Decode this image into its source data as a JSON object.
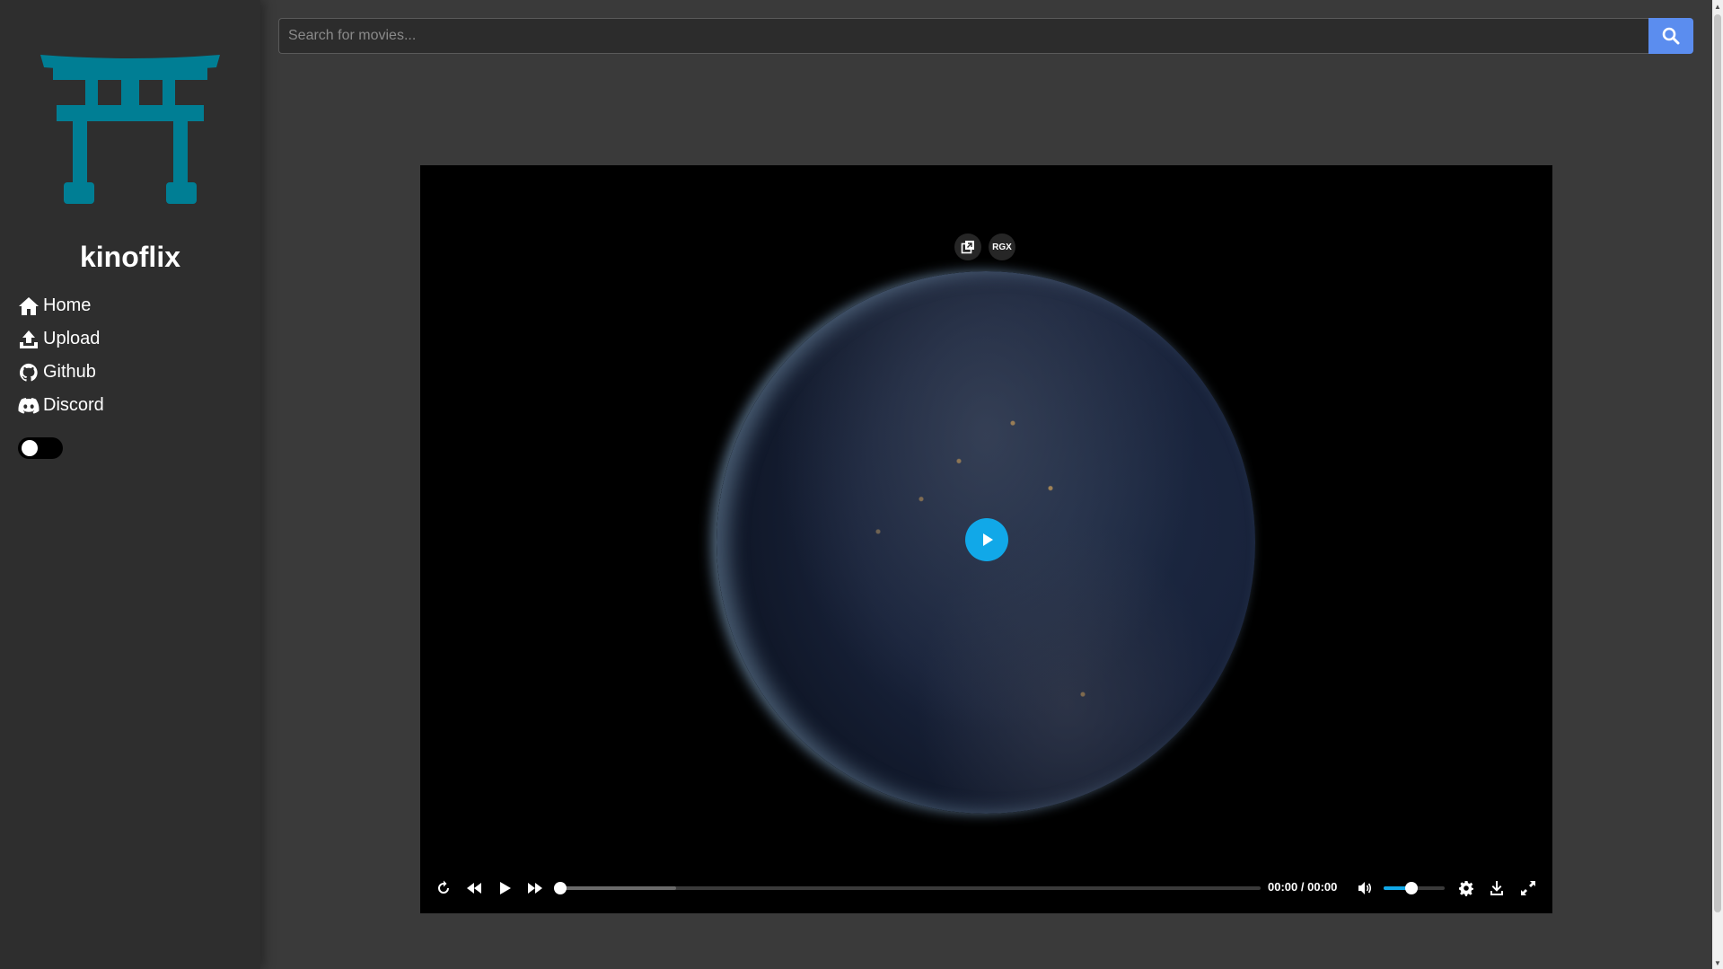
{
  "app": {
    "brand": "kinoflix"
  },
  "sidebar": {
    "items": [
      {
        "label": "Home",
        "icon": "home-icon"
      },
      {
        "label": "Upload",
        "icon": "upload-icon"
      },
      {
        "label": "Github",
        "icon": "github-icon"
      },
      {
        "label": "Discord",
        "icon": "discord-icon"
      }
    ],
    "theme_toggle_on": false
  },
  "search": {
    "placeholder": "Search for movies...",
    "value": ""
  },
  "player": {
    "top_buttons": {
      "pip_icon": "picture-in-picture-icon",
      "rgx_label": "RGX"
    },
    "current_time": "00:00",
    "separator": "/",
    "duration": "00:00",
    "progress": 0,
    "buffered": 0.165,
    "volume": 0.45
  },
  "colors": {
    "accent": "#11a8e8",
    "logo": "#007e94",
    "search_button": "#5b8def",
    "sidebar_bg": "#2e2e2e",
    "page_bg": "#3a3a3a"
  }
}
